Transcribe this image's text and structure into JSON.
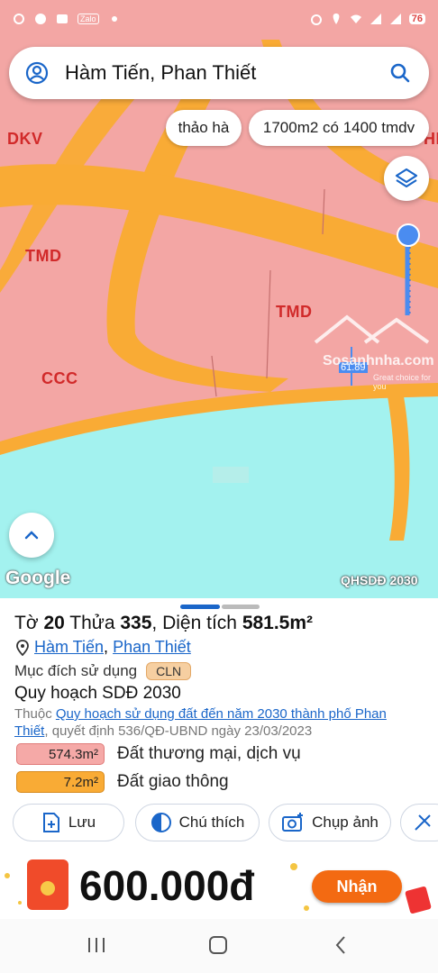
{
  "status_bar": {
    "left_icons": [
      "notification-icon",
      "globe-icon",
      "gallery-icon",
      "zalo-icon",
      "dot-icon"
    ],
    "zalo_label": "Zalo",
    "battery_label": "76"
  },
  "search": {
    "query": "Hàm Tiến, Phan Thiết"
  },
  "chips": {
    "chip1": "thảo hà",
    "chip2": "1700m2 có 1400 tmdv"
  },
  "map": {
    "labels": {
      "dkv": "DKV",
      "tmd1": "TMD",
      "tmd2": "TMD",
      "ccc": "CCC",
      "hd": "HD"
    },
    "pin_label": "61.89",
    "watermark_main": "Sosanhnha.com",
    "watermark_sub": "Great choice for you",
    "google_logo": "Google",
    "layer_label": "QHSDĐ 2030",
    "colors": {
      "land": "#f3a6a4",
      "road": "#f9ab35",
      "water": "#a3f2ef",
      "pin": "#4a8cf0"
    }
  },
  "parcel": {
    "to_label": "Tờ",
    "to_value": "20",
    "thua_label": "Thửa",
    "thua_value": "335",
    "area_label": ", Diện tích",
    "area_value": "581.5m²",
    "ward": "Hàm Tiến",
    "separator": ",",
    "city": "Phan Thiết",
    "purpose_label": "Mục đích sử dụng",
    "purpose_code": "CLN",
    "plan_title": "Quy hoạch SDĐ 2030",
    "belongs_prefix": "Thuộc",
    "plan_link_line1": "Quy hoạch sử dụng đất đến năm 2030 thành phố Phan",
    "plan_link_line2": "Thiết",
    "plan_decision": ", quyết định 536/QĐ-UBND ngày 23/03/2023",
    "zones": [
      {
        "value": "574.3m²",
        "label": "Đất thương mại, dịch vụ",
        "color": "#f5a9a7",
        "border": "#e07b79"
      },
      {
        "value": "7.2m²",
        "label": "Đất giao thông",
        "color": "#f9ab35",
        "border": "#d88a1c"
      }
    ]
  },
  "actions": [
    {
      "label": "Lưu",
      "icon": "save-icon"
    },
    {
      "label": "Chú thích",
      "icon": "legend-icon"
    },
    {
      "label": "Chụp ảnh",
      "icon": "camera-icon"
    }
  ],
  "promo": {
    "amount": "600.000đ",
    "button": "Nhận"
  },
  "navbar": {
    "items": [
      "recent-apps-icon",
      "home-icon",
      "back-icon"
    ]
  }
}
